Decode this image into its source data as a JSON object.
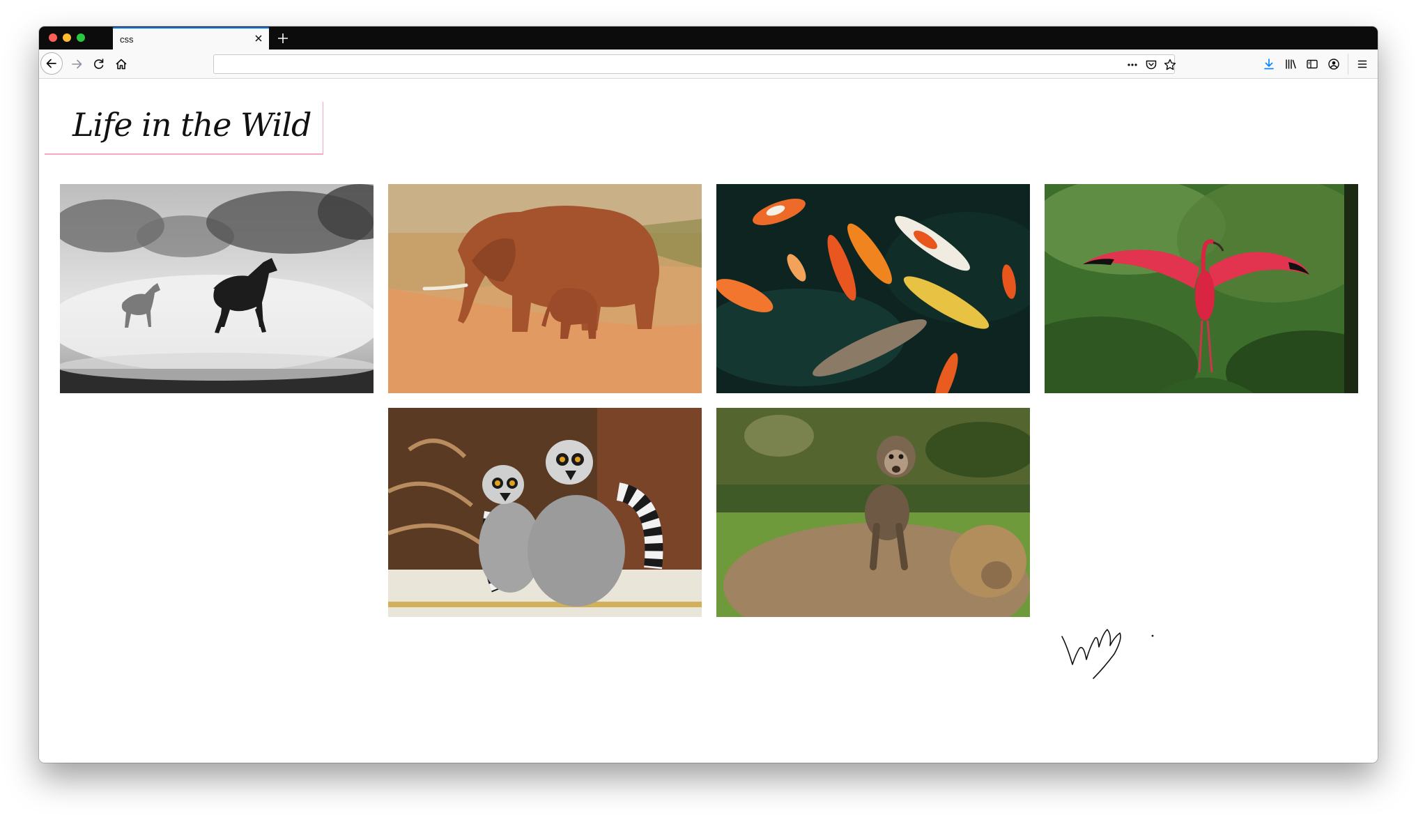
{
  "browser": {
    "tab_title": "css",
    "url_value": "",
    "url_placeholder": ""
  },
  "page": {
    "title": "Life in the Wild",
    "accent_color": "#f4a6c4"
  },
  "gallery": [
    {
      "subject": "horses-in-mist"
    },
    {
      "subject": "elephant-and-calf"
    },
    {
      "subject": "koi-fish"
    },
    {
      "subject": "scarlet-ibis"
    },
    {
      "subject": "ring-tailed-lemurs"
    },
    {
      "subject": "baby-monkey-on-macaque"
    }
  ],
  "colors": {
    "tab_active_border": "#0a84ff",
    "download_icon": "#0a84ff",
    "window_chrome": "#0c0c0d"
  },
  "signature": {
    "type": "handwritten-signature"
  }
}
